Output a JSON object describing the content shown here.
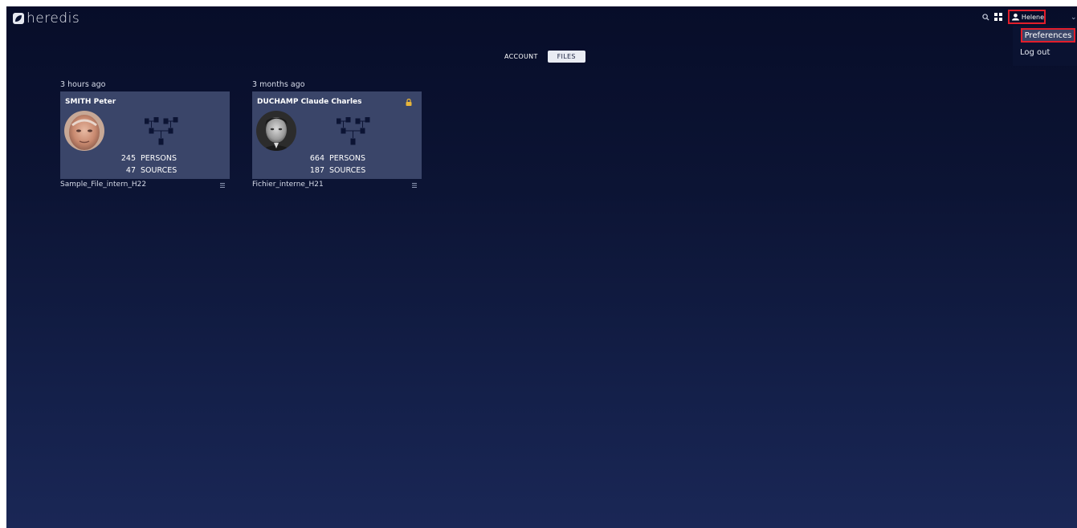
{
  "header": {
    "logo_text": "heredis",
    "search_icon": "search-icon",
    "apps_icon": "grid-icon",
    "user_icon": "user-icon",
    "user_name": "Helene",
    "chevron_icon": "chevron-down-icon"
  },
  "user_menu": {
    "preferences_label": "Preferences",
    "logout_label": "Log out"
  },
  "tabs": {
    "account_label": "ACCOUNT",
    "files_label": "FILES",
    "active": "FILES"
  },
  "files": [
    {
      "date": "3 hours ago",
      "name": "SMITH Peter",
      "persons_count": "245",
      "persons_label": "PERSONS",
      "sources_count": "47",
      "sources_label": "SOURCES",
      "file_name": "Sample_File_intern_H22",
      "locked": false
    },
    {
      "date": "3 months ago",
      "name": "DUCHAMP Claude Charles",
      "persons_count": "664",
      "persons_label": "PERSONS",
      "sources_count": "187",
      "sources_label": "SOURCES",
      "file_name": "Fichier_interne_H21",
      "locked": true
    }
  ],
  "colors": {
    "accent_highlight": "#e21e2b",
    "card_bg": "#3a4569",
    "lock": "#e8b53a",
    "tree_icon": "#0c1434"
  }
}
